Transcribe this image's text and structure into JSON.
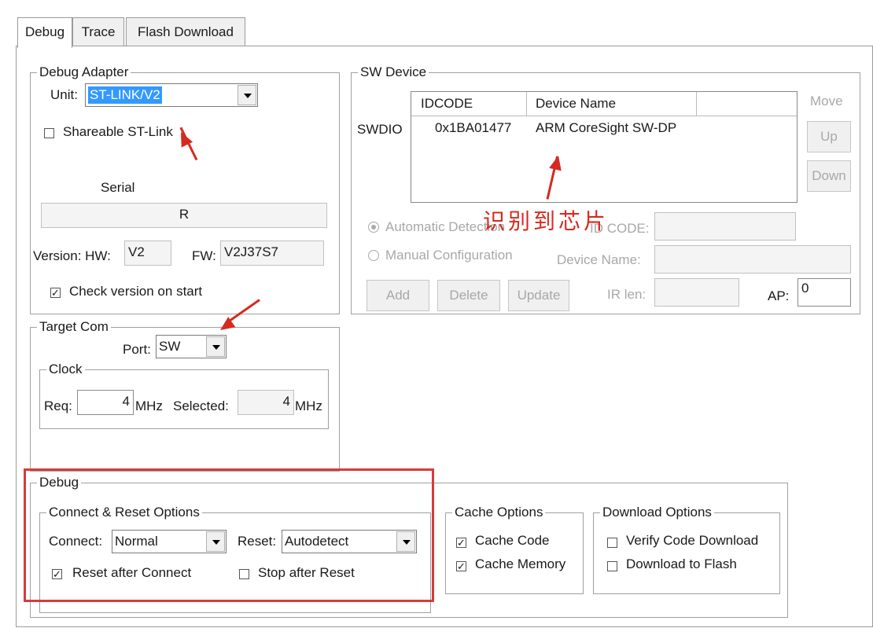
{
  "tabs": [
    "Debug",
    "Trace",
    "Flash Download"
  ],
  "debug_adapter": {
    "legend": "Debug Adapter",
    "unit_label": "Unit:",
    "unit_value": "ST-LINK/V2",
    "shareable_label": "Shareable ST-Link",
    "shareable_checked": false,
    "serial_label": "Serial",
    "serial_value": "R",
    "version_hw_label": "Version: HW:",
    "hw_value": "V2",
    "fw_label": "FW:",
    "fw_value": "V2J37S7",
    "check_version_label": "Check version on start",
    "check_version_checked": true
  },
  "target_com": {
    "legend": "Target Com",
    "port_label": "Port:",
    "port_value": "SW",
    "clock_legend": "Clock",
    "req_label": "Req:",
    "req_value": "4",
    "mhz1": "MHz",
    "selected_label": "Selected:",
    "selected_value": "4",
    "mhz2": "MHz"
  },
  "sw_device": {
    "legend": "SW Device",
    "move_label": "Move",
    "up_label": "Up",
    "down_label": "Down",
    "columns": [
      "IDCODE",
      "Device Name"
    ],
    "row_label": "SWDIO",
    "rows": [
      {
        "idcode": "0x1BA01477",
        "name": "ARM CoreSight SW-DP"
      }
    ],
    "auto_detect_label": "Automatic Detection",
    "manual_config_label": "Manual Configuration",
    "idcode_label": "ID CODE:",
    "device_name_label": "Device Name:",
    "add_label": "Add",
    "delete_label": "Delete",
    "update_label": "Update",
    "ir_len_label": "IR len:",
    "ap_label": "AP:",
    "ap_value": "0"
  },
  "annotation": {
    "text": "识别到芯片",
    "color": "#d62a20"
  },
  "debug": {
    "legend": "Debug",
    "connect_reset_legend": "Connect & Reset Options",
    "connect_label": "Connect:",
    "connect_value": "Normal",
    "reset_label": "Reset:",
    "reset_value": "Autodetect",
    "reset_after_connect_label": "Reset after Connect",
    "reset_after_connect_checked": true,
    "stop_after_reset_label": "Stop after Reset",
    "stop_after_reset_checked": false
  },
  "cache_options": {
    "legend": "Cache Options",
    "cache_code_label": "Cache Code",
    "cache_code_checked": true,
    "cache_memory_label": "Cache Memory",
    "cache_memory_checked": true
  },
  "download_options": {
    "legend": "Download Options",
    "verify_label": "Verify Code Download",
    "verify_checked": false,
    "flash_label": "Download to Flash",
    "flash_checked": false
  },
  "colors": {
    "highlight_box": "#d93a3a",
    "selection_bg": "#3399ff"
  }
}
